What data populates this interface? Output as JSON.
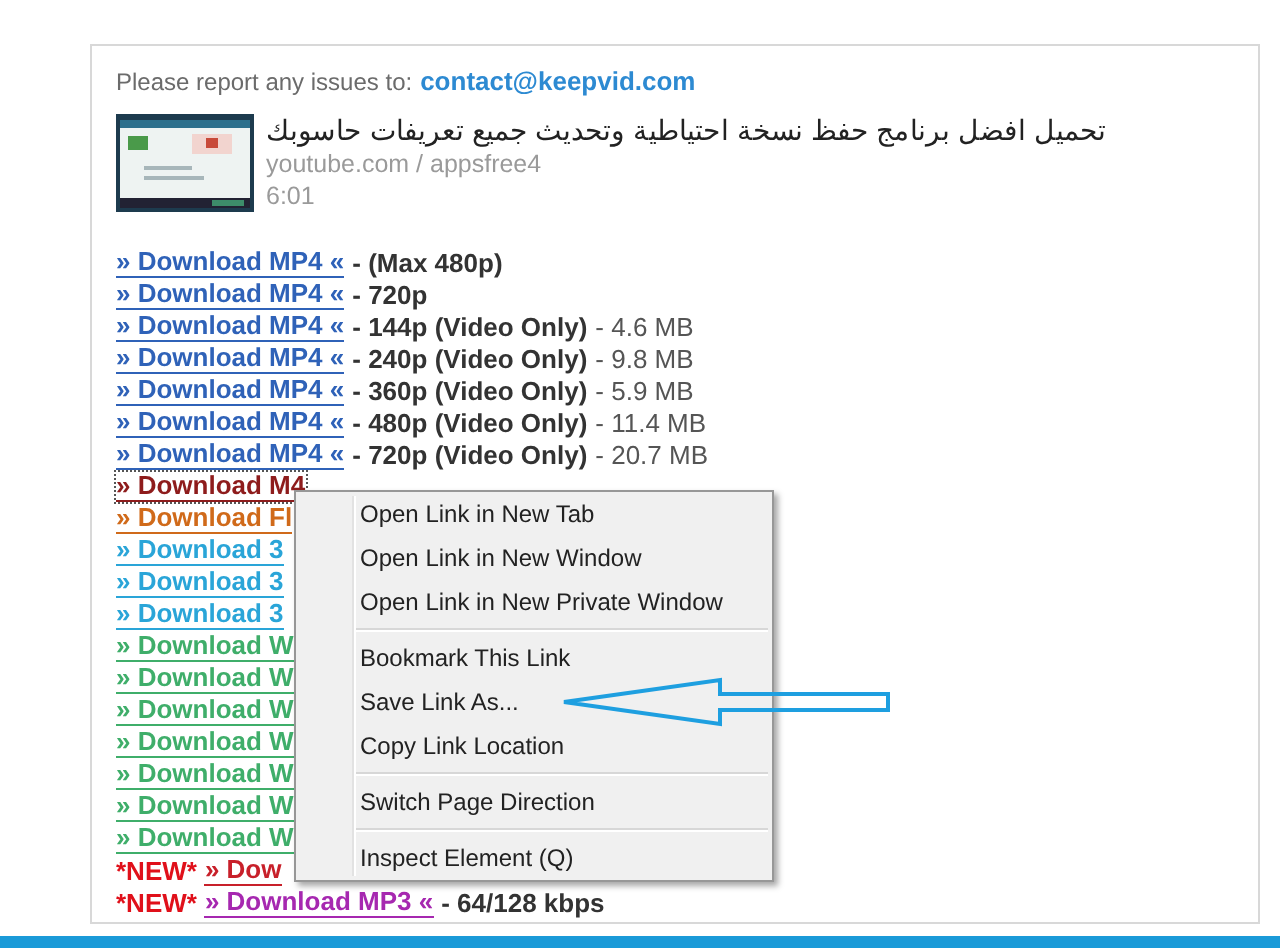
{
  "report": {
    "text": "Please report any issues to:",
    "email": "contact@keepvid.com"
  },
  "video": {
    "title": "تحميل افضل برنامج حفظ نسخة احتياطية وتحديث جميع تعريفات حاسوبك",
    "channel": "youtube.com / appsfree4",
    "duration": "6:01"
  },
  "downloads": [
    {
      "link": "» Download MP4 «",
      "color": "#2f62b8",
      "focused": false,
      "quality": "- (Max 480p)"
    },
    {
      "link": "» Download MP4 «",
      "color": "#2f62b8",
      "focused": false,
      "quality": "- 720p"
    },
    {
      "link": "» Download MP4 «",
      "color": "#2f62b8",
      "focused": false,
      "quality": "- 144p (Video Only)",
      "size": "- 4.6 MB"
    },
    {
      "link": "» Download MP4 «",
      "color": "#2f62b8",
      "focused": false,
      "quality": "- 240p (Video Only)",
      "size": "- 9.8 MB"
    },
    {
      "link": "» Download MP4 «",
      "color": "#2f62b8",
      "focused": false,
      "quality": "- 360p (Video Only)",
      "size": "- 5.9 MB"
    },
    {
      "link": "» Download MP4 «",
      "color": "#2f62b8",
      "focused": false,
      "quality": "- 480p (Video Only)",
      "size": "- 11.4 MB"
    },
    {
      "link": "» Download MP4 «",
      "color": "#2f62b8",
      "focused": false,
      "quality": "- 720p (Video Only)",
      "size": "- 20.7 MB"
    },
    {
      "link": "» Download M4",
      "color": "#8e1c1c",
      "focused": true
    },
    {
      "link": "» Download Fl",
      "color": "#d06a1a",
      "focused": false
    },
    {
      "link": "» Download 3",
      "color": "#2aa5d8",
      "focused": false
    },
    {
      "link": "» Download 3",
      "color": "#2aa5d8",
      "focused": false
    },
    {
      "link": "» Download 3",
      "color": "#2aa5d8",
      "focused": false
    },
    {
      "link": "» Download W",
      "color": "#3fae6a",
      "focused": false
    },
    {
      "link": "» Download W",
      "color": "#3fae6a",
      "focused": false
    },
    {
      "link": "» Download W",
      "color": "#3fae6a",
      "focused": false
    },
    {
      "link": "» Download W",
      "color": "#3fae6a",
      "focused": false
    },
    {
      "link": "» Download W",
      "color": "#3fae6a",
      "focused": false
    },
    {
      "link": "» Download W",
      "color": "#3fae6a",
      "focused": false
    },
    {
      "link": "» Download W",
      "color": "#3fae6a",
      "focused": false
    },
    {
      "badge": "*NEW*",
      "link": "» Dow",
      "color": "#c8202a",
      "focused": false
    },
    {
      "badge": "*NEW*",
      "link": "» Download MP3 «",
      "color": "#a628b0",
      "focused": false,
      "quality": "- 64/128 kbps"
    }
  ],
  "context_menu": {
    "groups": [
      [
        {
          "label": "Open Link in New Tab"
        },
        {
          "label": "Open Link in New Window"
        },
        {
          "label": "Open Link in New Private Window"
        }
      ],
      [
        {
          "label": "Bookmark This Link"
        },
        {
          "label": "Save Link As..."
        },
        {
          "label": "Copy Link Location"
        }
      ],
      [
        {
          "label": "Switch Page Direction"
        }
      ],
      [
        {
          "label": "Inspect Element (Q)"
        }
      ]
    ]
  }
}
